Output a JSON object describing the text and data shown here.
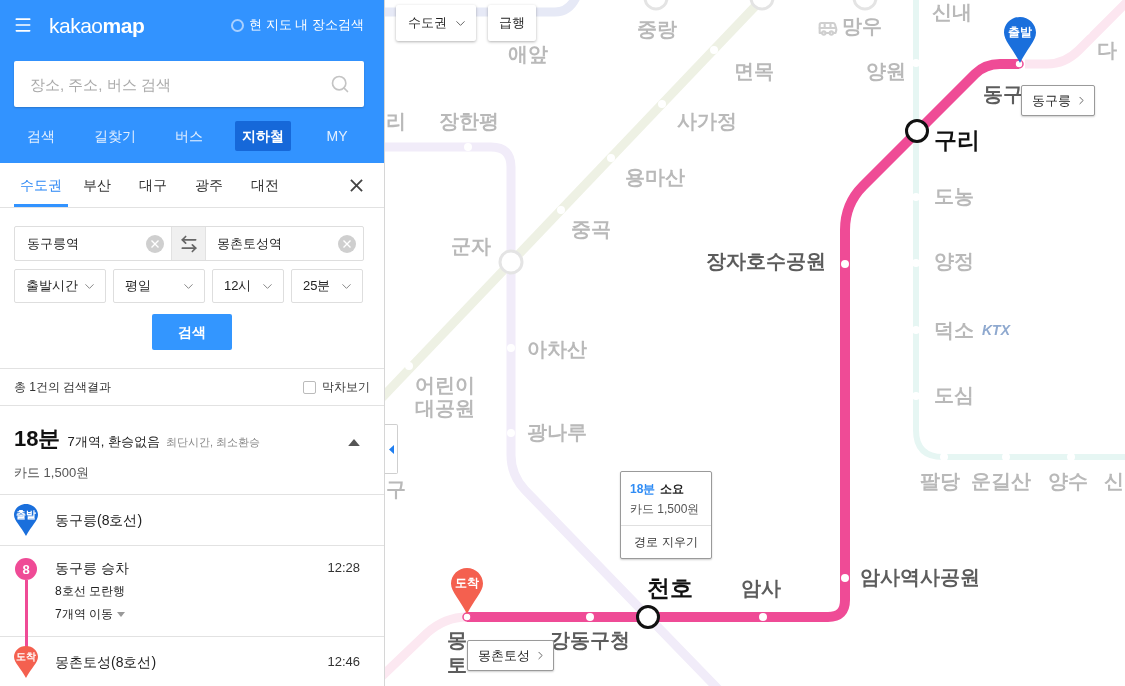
{
  "header": {
    "logo": "kakao**map**",
    "area_search": {
      "label": "현 지도 내 장소검색",
      "checked": false
    }
  },
  "search": {
    "placeholder": "장소, 주소, 버스 검색"
  },
  "main_tabs": [
    {
      "label": "검색",
      "selected": false
    },
    {
      "label": "길찾기",
      "selected": false
    },
    {
      "label": "버스",
      "selected": false
    },
    {
      "label": "지하철",
      "selected": true
    },
    {
      "label": "MY",
      "selected": false
    }
  ],
  "region_tabs": [
    {
      "label": "수도권",
      "selected": true
    },
    {
      "label": "부산",
      "selected": false
    },
    {
      "label": "대구",
      "selected": false
    },
    {
      "label": "광주",
      "selected": false
    },
    {
      "label": "대전",
      "selected": false
    }
  ],
  "route_form": {
    "origin": "동구릉역",
    "destination": "몽촌토성역",
    "selects": [
      "출발시간",
      "평일",
      "12시",
      "25분"
    ],
    "search_button": "검색"
  },
  "results_bar": {
    "count": "총 1건의 검색결과",
    "last_train": {
      "label": "막차보기",
      "checked": false
    }
  },
  "result": {
    "duration": "18분",
    "summary": "7개역, 환승없음",
    "tags": "최단시간, 최소환승",
    "fare": "카드 1,500원",
    "expanded": true
  },
  "steps": [
    {
      "kind": "start",
      "badge": "출발",
      "name": "동구릉(8호선)"
    },
    {
      "kind": "ride",
      "line": "8",
      "name": "동구릉 승차",
      "time": "12:28",
      "direction": "8호선 모란행",
      "stops": {
        "label": "7개역 이동",
        "expanded": false
      }
    },
    {
      "kind": "end",
      "badge": "도착",
      "name": "몽촌토성(8호선)",
      "time": "12:46"
    }
  ],
  "map": {
    "controls": {
      "region": "수도권",
      "express": "급행"
    },
    "labels": [
      {
        "text": "애앞",
        "kind": "faint"
      },
      {
        "text": "중랑",
        "kind": "faint"
      },
      {
        "text": "망우",
        "kind": "faint"
      },
      {
        "text": "신내",
        "kind": "faint"
      },
      {
        "text": "면목",
        "kind": "faint"
      },
      {
        "text": "양원",
        "kind": "faint"
      },
      {
        "text": "다",
        "kind": "faint"
      },
      {
        "text": "리",
        "kind": "faint"
      },
      {
        "text": "장한평",
        "kind": "faint"
      },
      {
        "text": "사가정",
        "kind": "faint"
      },
      {
        "text": "용마산",
        "kind": "faint"
      },
      {
        "text": "중곡",
        "kind": "faint"
      },
      {
        "text": "군자",
        "kind": "faint"
      },
      {
        "text": "도농",
        "kind": "faint"
      },
      {
        "text": "양정",
        "kind": "faint"
      },
      {
        "text": "덕소",
        "kind": "faint"
      },
      {
        "text": "KTX",
        "kind": "logo"
      },
      {
        "text": "아차산",
        "kind": "faint"
      },
      {
        "text": "어린이 대공원",
        "kind": "faint"
      },
      {
        "text": "광나루",
        "kind": "faint"
      },
      {
        "text": "도심",
        "kind": "faint"
      },
      {
        "text": "구",
        "kind": "faint"
      },
      {
        "text": "팔당",
        "kind": "faint"
      },
      {
        "text": "운길산",
        "kind": "faint"
      },
      {
        "text": "양수",
        "kind": "faint"
      },
      {
        "text": "신",
        "kind": "faint"
      },
      {
        "text": "동구",
        "kind": "route"
      },
      {
        "text": "장자호수공원",
        "kind": "route"
      },
      {
        "text": "암사역사공원",
        "kind": "route"
      },
      {
        "text": "암사",
        "kind": "route"
      },
      {
        "text": "강동구청",
        "kind": "route"
      },
      {
        "text": "몽",
        "kind": "route"
      },
      {
        "text": "토",
        "kind": "route"
      },
      {
        "text": "구리",
        "kind": "transfer"
      },
      {
        "text": "천호",
        "kind": "transfer"
      }
    ],
    "pins": [
      {
        "kind": "start",
        "label": "출발"
      },
      {
        "kind": "end",
        "label": "도착"
      }
    ],
    "callouts": [
      "동구릉",
      "몽촌토성"
    ],
    "popup": {
      "duration": "18분",
      "suffix": "소요",
      "fare": "카드 1,500원",
      "action": "경로 지우기"
    }
  }
}
